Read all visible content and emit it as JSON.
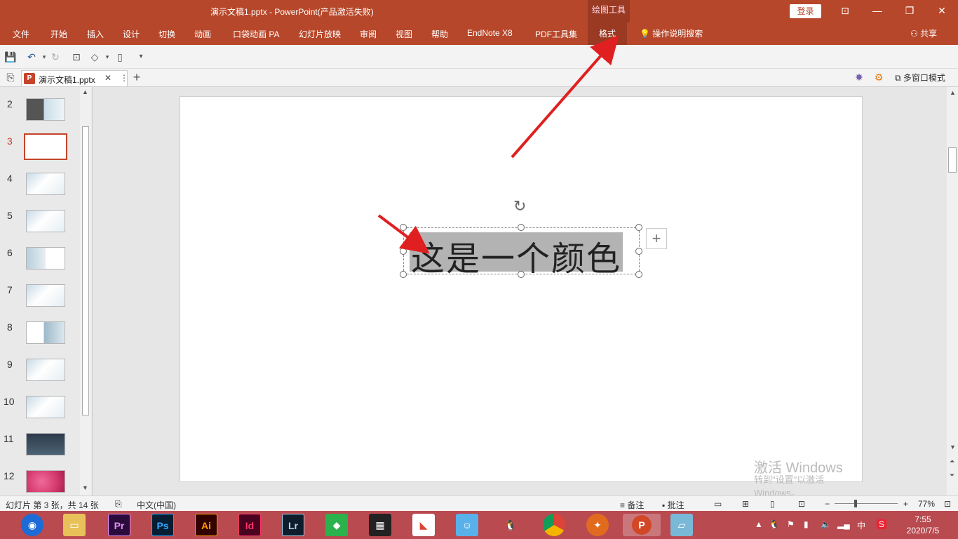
{
  "titlebar": {
    "title": "演示文稿1.pptx  -  PowerPoint(产品激活失败)",
    "context_group": "绘图工具",
    "login_label": "登录"
  },
  "ribbon": {
    "tabs": [
      "文件",
      "开始",
      "插入",
      "设计",
      "切换",
      "动画",
      "口袋动画 PA",
      "幻灯片放映",
      "审阅",
      "视图",
      "帮助",
      "EndNote X8",
      "PDF工具集",
      "格式"
    ],
    "active_tab": "格式",
    "tell_me": "操作说明搜索",
    "share": "共享"
  },
  "doc_tabs": {
    "file_name": "演示文稿1.pptx",
    "multi_window": "多窗口模式"
  },
  "thumbnails": {
    "numbers": [
      "2",
      "3",
      "4",
      "5",
      "6",
      "7",
      "8",
      "9",
      "10",
      "11",
      "12"
    ],
    "active": "3"
  },
  "slide": {
    "text": "这是一个颜色"
  },
  "watermark": {
    "line1": "激活 Windows",
    "line2": "转到\"设置\"以激活 Windows。"
  },
  "statusbar": {
    "slide_info": "幻灯片 第 3 张，共 14 张",
    "language": "中文(中国)",
    "notes": "备注",
    "comments": "批注",
    "zoom": "77%"
  },
  "taskbar": {
    "time": "7:55",
    "date": "2020/7/5",
    "ime": "中"
  },
  "colors": {
    "accent": "#b7472a",
    "taskbar": "#b84a50",
    "annotation_arrow": "#e02020"
  }
}
